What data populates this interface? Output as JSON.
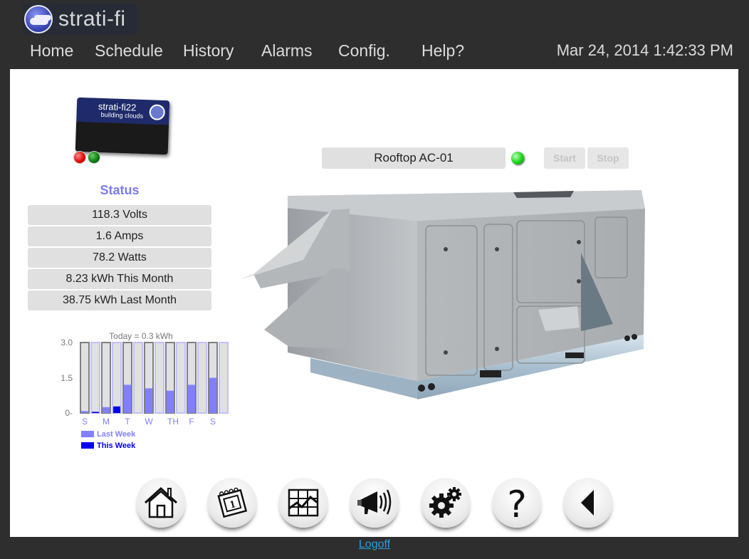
{
  "app": {
    "name": "strati-fi",
    "logo_icon": "cloud-icon"
  },
  "nav": {
    "items": [
      {
        "label": "Home"
      },
      {
        "label": "Schedule"
      },
      {
        "label": "History"
      },
      {
        "label": "Alarms"
      },
      {
        "label": "Config."
      },
      {
        "label": "Help?"
      }
    ],
    "datetime": "Mar 24, 2014 1:42:33 PM"
  },
  "device": {
    "board_title": "strati-fi22",
    "board_subtitle": "building clouds",
    "leds": [
      "red",
      "green"
    ]
  },
  "status": {
    "title": "Status",
    "rows": [
      {
        "label": "118.3 Volts"
      },
      {
        "label": "1.6 Amps"
      },
      {
        "label": "78.2 Watts"
      },
      {
        "label": "8.23 kWh This Month"
      },
      {
        "label": "38.75 kWh Last Month"
      }
    ]
  },
  "unit": {
    "name": "Rooftop AC-01",
    "running_indicator": "green",
    "start_label": "Start",
    "stop_label": "Stop",
    "image": "rooftop-hvac-unit"
  },
  "chart_data": {
    "type": "bar",
    "title": "Today = 0.3 kWh",
    "categories": [
      "S",
      "M",
      "T",
      "W",
      "TH",
      "F",
      "S"
    ],
    "series": [
      {
        "name": "Last Week",
        "color": "#8080ff",
        "values": [
          0.08,
          0.25,
          1.2,
          1.05,
          0.95,
          1.2,
          1.5
        ]
      },
      {
        "name": "This Week",
        "color": "#0000ee",
        "values": [
          0.05,
          0.28,
          0,
          0,
          0,
          0,
          0
        ]
      }
    ],
    "yticks": [
      "3.0",
      "1.5",
      "0-"
    ],
    "ylim": [
      0,
      3.0
    ],
    "xlabel": "",
    "ylabel": "",
    "legend_position": "bottom-left",
    "grid": false
  },
  "toolbar": {
    "buttons": [
      {
        "name": "home",
        "icon": "home-icon"
      },
      {
        "name": "schedule",
        "icon": "calendar-icon"
      },
      {
        "name": "history",
        "icon": "chart-icon"
      },
      {
        "name": "alarms",
        "icon": "megaphone-icon"
      },
      {
        "name": "config",
        "icon": "gears-icon"
      },
      {
        "name": "help",
        "icon": "question-icon"
      },
      {
        "name": "back",
        "icon": "back-arrow-icon"
      }
    ]
  },
  "footer": {
    "logoff_label": "Logoff"
  }
}
